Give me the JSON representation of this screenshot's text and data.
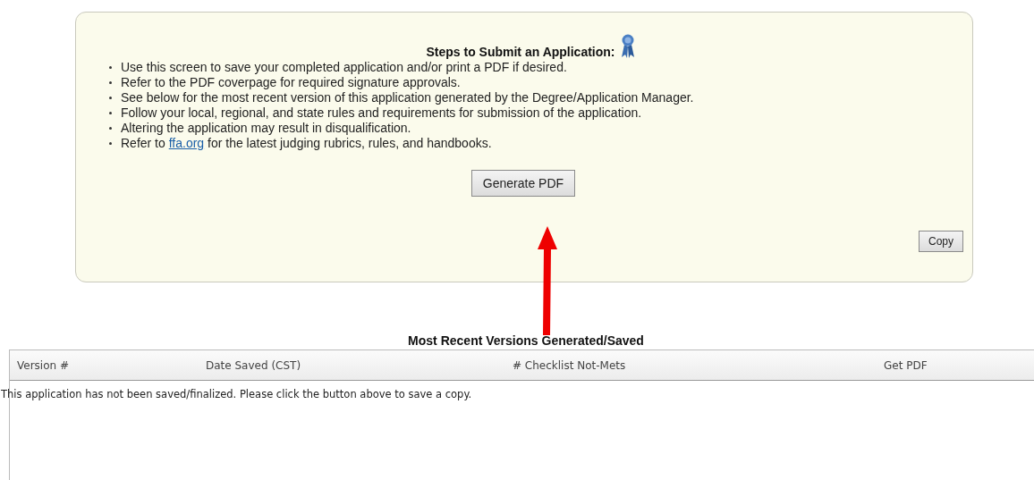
{
  "instructions": {
    "title": "Steps to Submit an Application:",
    "steps": [
      {
        "text": "Use this screen to save your completed application and/or print a PDF if desired."
      },
      {
        "text": "Refer to the PDF coverpage for required signature approvals."
      },
      {
        "text": "See below for the most recent version of this application generated by the Degree/Application Manager."
      },
      {
        "text": "Follow your local, regional, and state rules and requirements for submission of the application."
      },
      {
        "text": "Altering the application may result in disqualification."
      },
      {
        "text": "Refer to",
        "link": "ffa.org",
        "after": "for the latest judging rubrics, rules, and handbooks."
      }
    ],
    "primary_button": "Generate PDF",
    "copy_button": "Copy"
  },
  "versions": {
    "title": "Most Recent Versions Generated/Saved",
    "columns": [
      "Version #",
      "Date Saved (CST)",
      "# Checklist Not-Mets",
      "Get PDF"
    ],
    "empty_message": "This application has not been saved/finalized. Please click the button above to save a copy."
  }
}
